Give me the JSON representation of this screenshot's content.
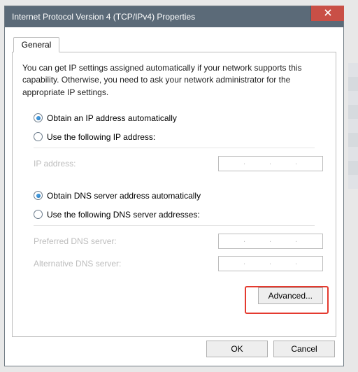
{
  "window": {
    "title": "Internet Protocol Version 4 (TCP/IPv4) Properties"
  },
  "tab": {
    "label": "General"
  },
  "intro": "You can get IP settings assigned automatically if your network supports this capability. Otherwise, you need to ask your network administrator for the appropriate IP settings.",
  "ip": {
    "auto_label": "Obtain an IP address automatically",
    "manual_label": "Use the following IP address:",
    "address_label": "IP address:",
    "address_value": ""
  },
  "dns": {
    "auto_label": "Obtain DNS server address automatically",
    "manual_label": "Use the following DNS server addresses:",
    "preferred_label": "Preferred DNS server:",
    "preferred_value": "",
    "alternate_label": "Alternative DNS server:",
    "alternate_value": ""
  },
  "buttons": {
    "advanced": "Advanced...",
    "ok": "OK",
    "cancel": "Cancel"
  },
  "ip_placeholder_dots": {
    "d1": ".",
    "d2": ".",
    "d3": "."
  }
}
